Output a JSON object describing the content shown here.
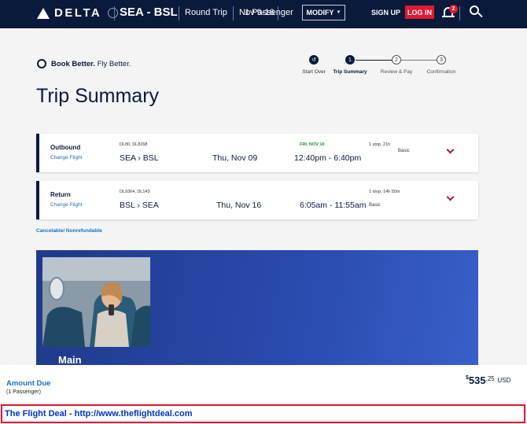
{
  "nav": {
    "logo_text": "DELTA",
    "route": "SEA - BSL",
    "trip_type": "Round Trip",
    "dates": "Nov 9-16",
    "passengers": "1 Passenger",
    "modify_label": "MODIFY",
    "signup_label": "SIGN UP",
    "login_label": "LOG IN",
    "notification_count": "2",
    "icons": [
      "delta-widget-icon",
      "bell-icon",
      "search-icon",
      "chevron-down-icon"
    ]
  },
  "book_better": {
    "label_bold": "Book Better.",
    "label_rest": " Fly Better."
  },
  "progress": {
    "steps": [
      {
        "num": "",
        "label": "Start Over"
      },
      {
        "num": "1",
        "label": "Trip Summary"
      },
      {
        "num": "2",
        "label": "Review & Pay"
      },
      {
        "num": "3",
        "label": "Confirmation"
      }
    ]
  },
  "page_title": "Trip Summary",
  "flights": [
    {
      "direction": "Outbound",
      "change_label": "Change Flight",
      "flight_numbers": "DL80, DL8268",
      "route": "SEA › BSL",
      "date": "Thu, Nov 09",
      "arrival_date": "FRI, NOV 10",
      "times": "12:40pm - 6:40pm",
      "stops": "1 stop, 21h",
      "cabin": "Basic"
    },
    {
      "direction": "Return",
      "change_label": "Change Flight",
      "flight_numbers": "DL9364, DL143",
      "route": "BSL › SEA",
      "date": "Thu, Nov 16",
      "arrival_date": "",
      "times": "6:05am - 11:55am",
      "stops": "1 stop, 14h 50m",
      "cabin": "Basic"
    }
  ],
  "cancel_note": "Cancelable/ Nonrefundable",
  "fare": {
    "cabin_label": "Main"
  },
  "amount_due": {
    "label": "Amount Due",
    "passengers": "(1 Passenger)",
    "currency_symbol": "$",
    "dollars": "535",
    "cents": ".25",
    "currency": "USD"
  },
  "banner": {
    "text": "The Flight Deal - http://www.theflightdeal.com"
  },
  "colors": {
    "navy": "#0a1a3a",
    "accent_red": "#e01933",
    "link_blue": "#1a6fbf"
  }
}
